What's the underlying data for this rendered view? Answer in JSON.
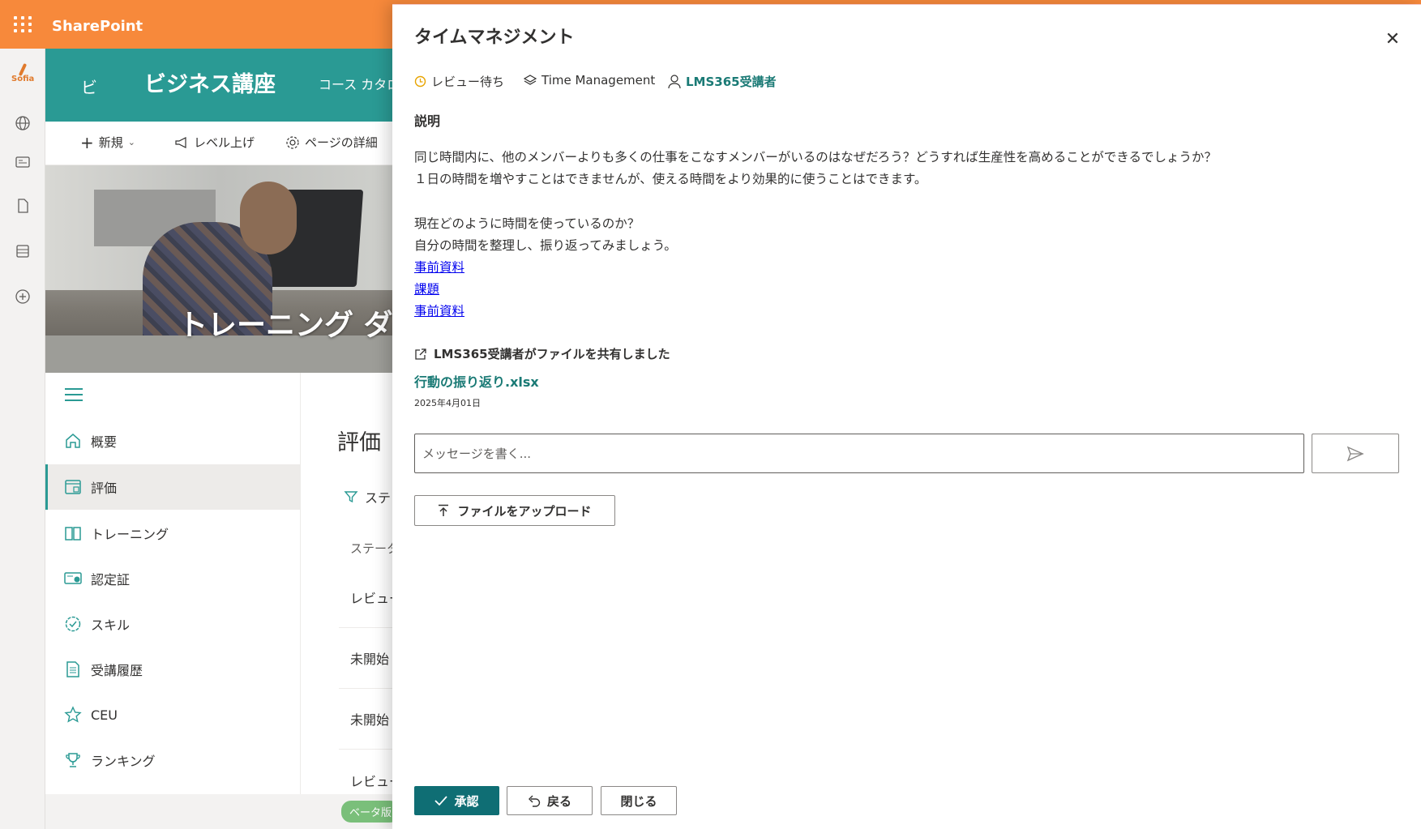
{
  "suite": {
    "brand": "SharePoint"
  },
  "rail": {
    "logo_text": "Sofia"
  },
  "site": {
    "logo_char": "ビ",
    "title": "ビジネス講座",
    "nav_course_catalog": "コース カタロ"
  },
  "commandbar": {
    "new_label": "新規",
    "promote_label": "レベル上げ",
    "page_details_label": "ページの詳細"
  },
  "hero": {
    "title": "トレーニング ダ"
  },
  "leftnav": {
    "items": [
      {
        "label": "概要",
        "icon": "home-icon"
      },
      {
        "label": "評価",
        "icon": "evaluation-icon"
      },
      {
        "label": "トレーニング",
        "icon": "book-icon"
      },
      {
        "label": "認定証",
        "icon": "certificate-icon"
      },
      {
        "label": "スキル",
        "icon": "badge-icon"
      },
      {
        "label": "受講履歴",
        "icon": "history-icon"
      },
      {
        "label": "CEU",
        "icon": "star-icon"
      },
      {
        "label": "ランキング",
        "icon": "trophy-icon"
      }
    ]
  },
  "main": {
    "heading": "評価",
    "filter_label": "ステ",
    "column_status": "ステータ",
    "rows": [
      "レビュー",
      "未開始",
      "未開始",
      "レビュー"
    ],
    "beta_label": "ベータ版"
  },
  "panel": {
    "title": "タイムマネジメント",
    "status": "レビュー待ち",
    "course": "Time Management",
    "assignee": "LMS365受講者",
    "section_title": "説明",
    "description_lines": [
      "同じ時間内に、他のメンバーよりも多くの仕事をこなすメンバーがいるのはなぜだろう？どうすれば生産性を高めることができるでしょうか？",
      "１日の時間を増やすことはできませんが、使える時間をより効果的に使うことはできます。",
      "現在どのように時間を使っているのか？",
      "自分の時間を整理し、振り返ってみましょう。"
    ],
    "links": [
      "事前資料",
      "課題",
      "事前資料"
    ],
    "shared_text": "LMS365受講者がファイルを共有しました",
    "file_name": "行動の振り返り.xlsx",
    "file_date": "2025年4月01日",
    "message_placeholder": "メッセージを書く...",
    "upload_label": "ファイルをアップロード",
    "approve_label": "承認",
    "return_label": "戻る",
    "close_label": "閉じる"
  },
  "colors": {
    "suite_orange": "#f7893b",
    "site_teal": "#2a9a94",
    "primary_button": "#0f6e74",
    "status_amber": "#e8a400"
  }
}
